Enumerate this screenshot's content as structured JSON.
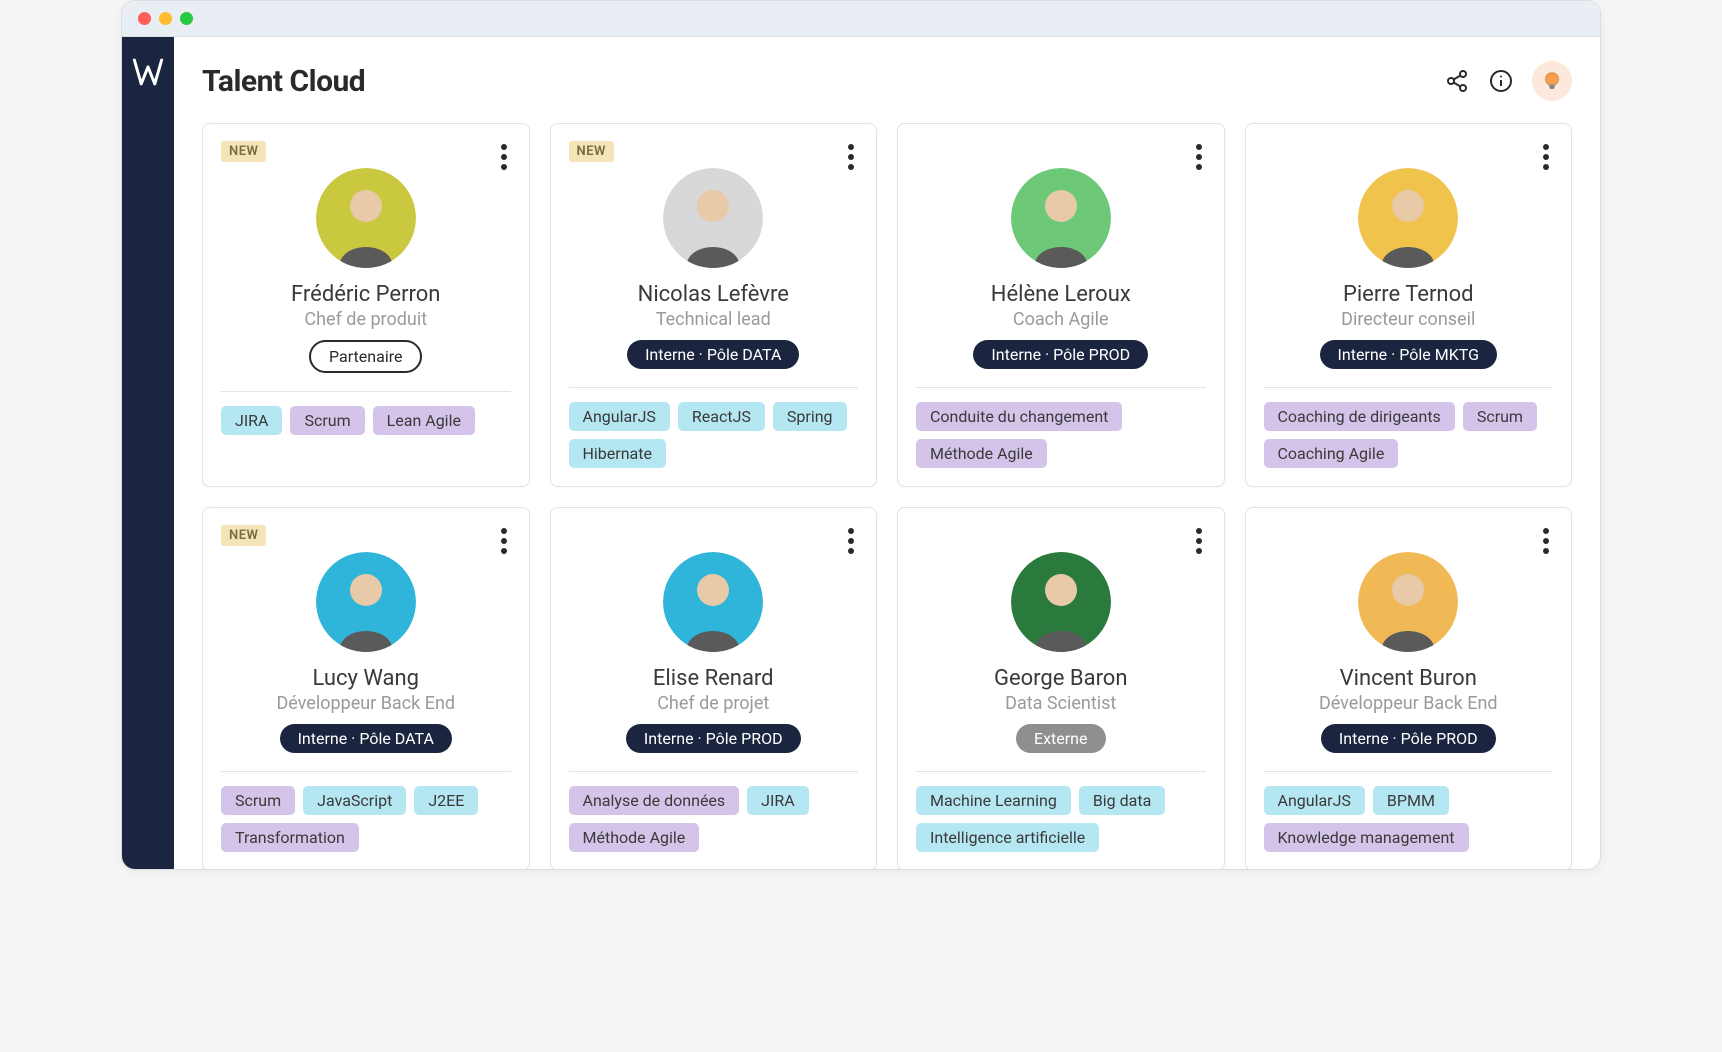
{
  "page_title": "Talent Cloud",
  "new_label": "NEW",
  "avatar_colors": [
    "#c9c83f",
    "#d8d8d8",
    "#6dc978",
    "#f0c44c",
    "#2eb5d9",
    "#2eb5d9",
    "#2a7a3d",
    "#f0b956"
  ],
  "cards": [
    {
      "name": "Frédéric Perron",
      "role": "Chef de produit",
      "badge": "Partenaire",
      "badge_style": "outline",
      "new": true,
      "tags": [
        {
          "label": "JIRA",
          "style": "blue"
        },
        {
          "label": "Scrum",
          "style": "purple"
        },
        {
          "label": "Lean Agile",
          "style": "purple"
        }
      ]
    },
    {
      "name": "Nicolas Lefèvre",
      "role": "Technical lead",
      "badge": "Interne · Pôle DATA",
      "badge_style": "dark",
      "new": true,
      "tags": [
        {
          "label": "AngularJS",
          "style": "blue"
        },
        {
          "label": "ReactJS",
          "style": "blue"
        },
        {
          "label": "Spring",
          "style": "blue"
        },
        {
          "label": "Hibernate",
          "style": "blue"
        }
      ]
    },
    {
      "name": "Hélène Leroux",
      "role": "Coach Agile",
      "badge": "Interne · Pôle PROD",
      "badge_style": "dark",
      "new": false,
      "tags": [
        {
          "label": "Conduite du changement",
          "style": "purple"
        },
        {
          "label": "Méthode Agile",
          "style": "purple"
        }
      ]
    },
    {
      "name": "Pierre Ternod",
      "role": "Directeur conseil",
      "badge": "Interne · Pôle MKTG",
      "badge_style": "dark",
      "new": false,
      "tags": [
        {
          "label": "Coaching de dirigeants",
          "style": "purple"
        },
        {
          "label": "Scrum",
          "style": "purple"
        },
        {
          "label": "Coaching Agile",
          "style": "purple"
        }
      ]
    },
    {
      "name": "Lucy Wang",
      "role": "Développeur Back End",
      "badge": "Interne · Pôle DATA",
      "badge_style": "dark",
      "new": true,
      "tags": [
        {
          "label": "Scrum",
          "style": "purple"
        },
        {
          "label": "JavaScript",
          "style": "blue"
        },
        {
          "label": "J2EE",
          "style": "blue"
        },
        {
          "label": "Transformation",
          "style": "purple"
        }
      ]
    },
    {
      "name": "Elise Renard",
      "role": "Chef de projet",
      "badge": "Interne · Pôle PROD",
      "badge_style": "dark",
      "new": false,
      "tags": [
        {
          "label": "Analyse de données",
          "style": "purple"
        },
        {
          "label": "JIRA",
          "style": "blue"
        },
        {
          "label": "Méthode Agile",
          "style": "purple"
        }
      ]
    },
    {
      "name": "George Baron",
      "role": "Data Scientist",
      "badge": "Externe",
      "badge_style": "grey",
      "new": false,
      "tags": [
        {
          "label": "Machine Learning",
          "style": "blue"
        },
        {
          "label": "Big data",
          "style": "blue"
        },
        {
          "label": "Intelligence artificielle",
          "style": "blue"
        }
      ]
    },
    {
      "name": "Vincent Buron",
      "role": "Développeur Back End",
      "badge": "Interne · Pôle PROD",
      "badge_style": "dark",
      "new": false,
      "tags": [
        {
          "label": "AngularJS",
          "style": "blue"
        },
        {
          "label": "BPMM",
          "style": "blue"
        },
        {
          "label": "Knowledge management",
          "style": "purple"
        }
      ]
    }
  ]
}
